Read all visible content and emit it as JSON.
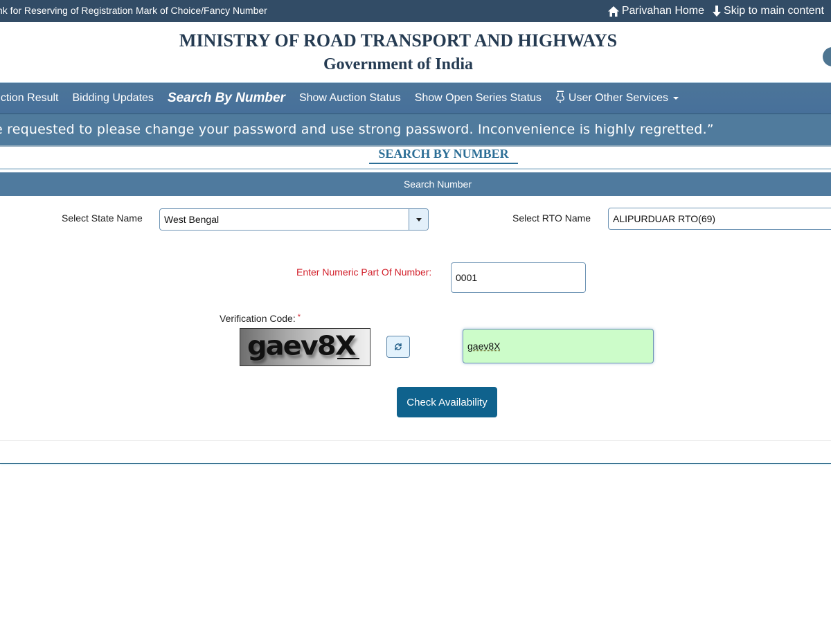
{
  "topbar": {
    "tagline": "nk for Reserving of Registration Mark of Choice/Fancy Number",
    "links": [
      {
        "label": "Parivahan Home",
        "icon": "home-icon"
      },
      {
        "label": "Skip to main content",
        "icon": "arrow-down-icon"
      }
    ]
  },
  "header": {
    "title": "MINISTRY OF ROAD TRANSPORT AND HIGHWAYS",
    "subtitle": "Government of India"
  },
  "nav": {
    "items": [
      {
        "label": "uction Result"
      },
      {
        "label": "Bidding Updates"
      },
      {
        "label": "Search By Number",
        "active": true
      },
      {
        "label": "Show Auction Status"
      },
      {
        "label": "Show Open Series Status"
      },
      {
        "label": "User Other Services",
        "icon": "hand-pointer-icon",
        "dropdown": true
      }
    ]
  },
  "marquee": {
    "text": "e requested to please change your password and use strong password. Inconvenience is highly regretted.”"
  },
  "section": {
    "title": "SEARCH BY NUMBER",
    "panel_heading": "Search Number"
  },
  "form": {
    "state_label": "Select State Name",
    "state_value": "West Bengal",
    "rto_label": "Select RTO Name",
    "rto_value": "ALIPURDUAR RTO(69)",
    "numeric_label": "Enter Numeric Part Of Number:",
    "numeric_value": "0001",
    "verification_label": "Verification Code:",
    "required_mark": "*",
    "captcha_image_text": "gaev8X",
    "captcha_value": "gaev8X",
    "submit_label": "Check Availability"
  },
  "colors": {
    "topbar": "#324c66",
    "nav": "#4c7599",
    "accent": "#0f628d",
    "captcha_input_bg": "#ccfcc9",
    "required": "#d21f2a"
  }
}
